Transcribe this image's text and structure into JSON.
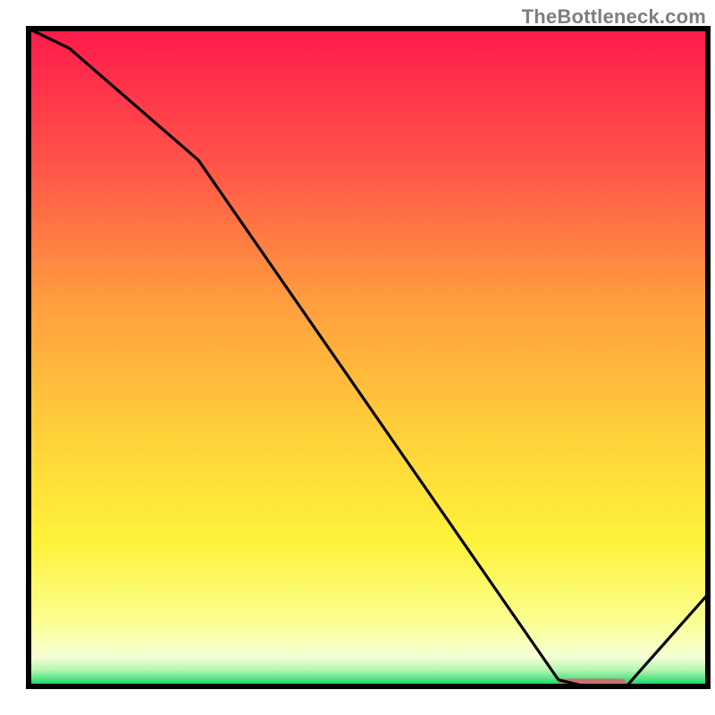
{
  "watermark": "TheBottleneck.com",
  "chart_data": {
    "type": "line",
    "title": "",
    "xlabel": "",
    "ylabel": "",
    "xlim": [
      0,
      100
    ],
    "ylim": [
      0,
      100
    ],
    "x": [
      0,
      6,
      25,
      78,
      82,
      88,
      100
    ],
    "values": [
      100,
      97,
      80,
      1,
      0,
      0,
      14
    ],
    "flat_zone": {
      "x_start": 78,
      "x_end": 88,
      "y": 0.5
    },
    "background_gradient": {
      "stops": [
        {
          "offset": 0.0,
          "color": "#ff1a4b"
        },
        {
          "offset": 0.2,
          "color": "#ff524a"
        },
        {
          "offset": 0.42,
          "color": "#ff9f3e"
        },
        {
          "offset": 0.63,
          "color": "#ffd43a"
        },
        {
          "offset": 0.78,
          "color": "#fff23a"
        },
        {
          "offset": 0.9,
          "color": "#fbff8f"
        },
        {
          "offset": 0.955,
          "color": "#f6ffd5"
        },
        {
          "offset": 0.975,
          "color": "#b7f6b2"
        },
        {
          "offset": 0.992,
          "color": "#3ae07a"
        },
        {
          "offset": 1.0,
          "color": "#17c85a"
        }
      ]
    },
    "flat_marker_color": "#cc6f6a",
    "line_color": "#000000",
    "border_color": "#000000"
  }
}
